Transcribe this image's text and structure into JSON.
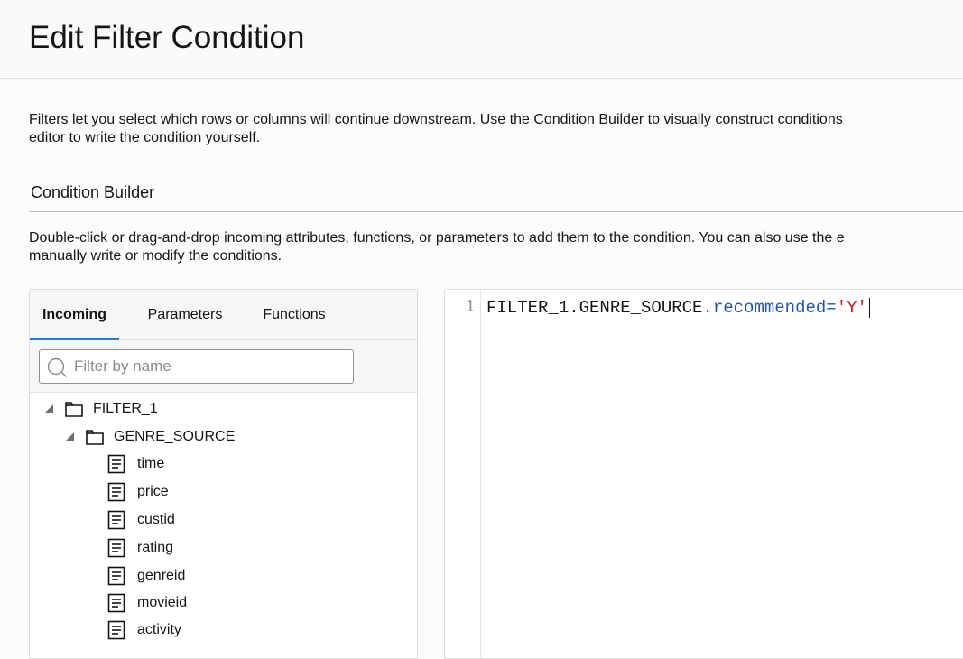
{
  "dialog": {
    "title": "Edit Filter Condition"
  },
  "intro": {
    "line1": "Filters let you select which rows or columns will continue downstream. Use the Condition Builder to visually construct conditions",
    "line2": "editor to write the condition yourself."
  },
  "condition_builder": {
    "heading": "Condition Builder",
    "desc_line1": "Double-click or drag-and-drop incoming attributes, functions, or parameters to add them to the condition. You can also use the e",
    "desc_line2": "manually write or modify the conditions."
  },
  "tabs": [
    {
      "label": "Incoming",
      "active": true
    },
    {
      "label": "Parameters",
      "active": false
    },
    {
      "label": "Functions",
      "active": false
    }
  ],
  "search": {
    "placeholder": "Filter by name",
    "value": ""
  },
  "tree": {
    "root": {
      "label": "FILTER_1",
      "icon": "folder-icon",
      "expanded": true
    },
    "child": {
      "label": "GENRE_SOURCE",
      "icon": "folder-icon",
      "expanded": true
    },
    "attributes": [
      "time",
      "price",
      "custid",
      "rating",
      "genreid",
      "movieid",
      "activity"
    ]
  },
  "editor": {
    "line_number": "1",
    "code_ident": "FILTER_1.GENRE_SOURCE",
    "code_prop": ".recommended=",
    "code_str": "'Y'"
  },
  "colors": {
    "accent": "#227dc2",
    "code_property": "#2357a6",
    "code_string": "#b0241d"
  }
}
